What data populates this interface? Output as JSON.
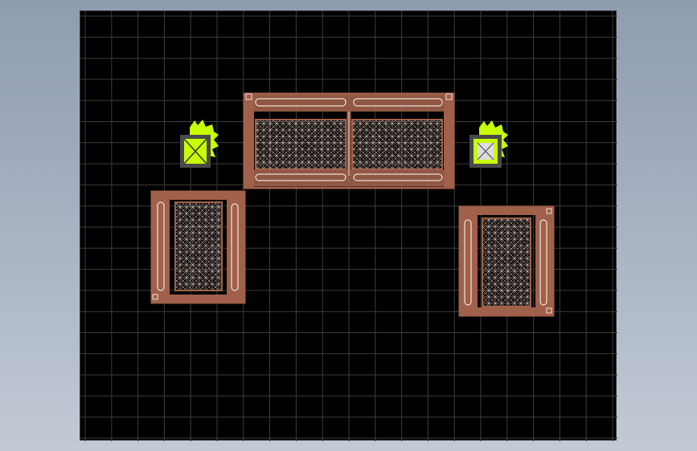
{
  "app": {
    "background_top": "#8f9cb0",
    "background_bottom": "#c3cad5"
  },
  "viewport": {
    "background": "#000000",
    "grid_color": "#3c3c3c",
    "grid_visible": true,
    "furniture_color": "#a0604a",
    "wireframe_color": "#ffffff",
    "lamp_color": "#c8ff00"
  },
  "objects": [
    {
      "id": "sofa",
      "kind": "three-seat sofa",
      "seats": 2
    },
    {
      "id": "armchair-left",
      "kind": "armchair"
    },
    {
      "id": "armchair-right",
      "kind": "armchair"
    },
    {
      "id": "lamp-left",
      "kind": "side table lamp"
    },
    {
      "id": "lamp-right",
      "kind": "side table lamp"
    }
  ]
}
